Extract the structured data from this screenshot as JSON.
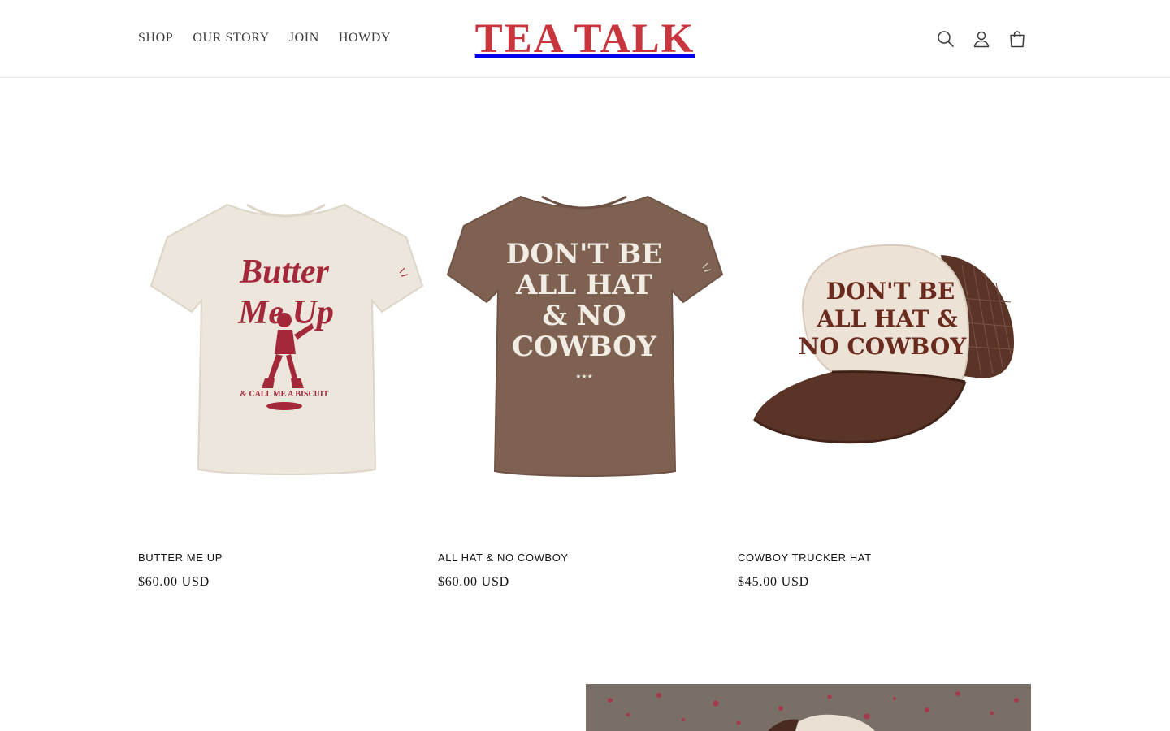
{
  "header": {
    "nav": [
      {
        "label": "SHOP"
      },
      {
        "label": "OUR STORY"
      },
      {
        "label": "JOIN"
      },
      {
        "label": "HOWDY"
      }
    ],
    "logo_text": "TEA TALK",
    "icons": [
      "search-icon",
      "account-icon",
      "cart-icon"
    ]
  },
  "products": [
    {
      "title": "BUTTER ME UP",
      "price": "$60.00 USD",
      "image_text": [
        "Butter",
        "Me Up",
        "& CALL ME A BISCUIT"
      ],
      "color": "#ece6dc",
      "print_color": "#a3283a"
    },
    {
      "title": "ALL HAT & NO COWBOY",
      "price": "$60.00 USD",
      "image_text": [
        "DON'T BE",
        "ALL HAT",
        "& NO",
        "COWBOY",
        "★★★"
      ],
      "color": "#7e6151",
      "print_color": "#f1ece4"
    },
    {
      "title": "COWBOY TRUCKER HAT",
      "price": "$45.00 USD",
      "image_text": [
        "DON'T BE",
        "ALL HAT &",
        "NO COWBOY"
      ],
      "color": "#5a3427",
      "print_color": "#6a2a1e"
    }
  ],
  "colors": {
    "brand": "#c8353c",
    "text": "#121212",
    "border": "#e6e6e6"
  }
}
